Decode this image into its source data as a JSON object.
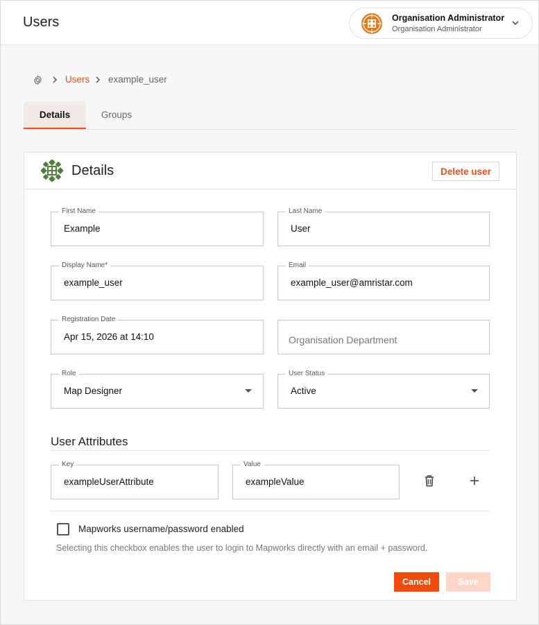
{
  "header": {
    "title": "Users",
    "org": {
      "name": "Organisation Administrator",
      "role": "Organisation Administrator",
      "logo_icon": "organisation-logo-icon",
      "logo_color": "#e07b1e"
    }
  },
  "breadcrumb": {
    "home_icon": "gear-icon",
    "users": "Users",
    "current": "example_user"
  },
  "tabs": [
    {
      "label": "Details",
      "active": true
    },
    {
      "label": "Groups",
      "active": false
    }
  ],
  "card": {
    "title": "Details",
    "icon_color": "#4f7f3a",
    "delete_label": "Delete user"
  },
  "form": {
    "first_name": {
      "label": "First Name",
      "value": "Example"
    },
    "last_name": {
      "label": "Last Name",
      "value": "User"
    },
    "display_name": {
      "label": "Display Name*",
      "value": "example_user"
    },
    "email": {
      "label": "Email",
      "value": "example_user@amristar.com"
    },
    "registration_date": {
      "label": "Registration Date",
      "value": "Apr 15, 2026 at 14:10"
    },
    "department": {
      "placeholder": "Organisation Department"
    },
    "role": {
      "label": "Role",
      "value": "Map Designer"
    },
    "user_status": {
      "label": "User Status",
      "value": "Active"
    }
  },
  "attributes": {
    "title": "User Attributes",
    "rows": [
      {
        "key_label": "Key",
        "key": "exampleUserAttribute",
        "value_label": "Value",
        "value": "exampleValue"
      }
    ]
  },
  "password_option": {
    "label": "Mapworks username/password enabled",
    "checked": false,
    "hint": "Selecting this checkbox enables the user to login to Mapworks directly with an email + password."
  },
  "actions": {
    "cancel": "Cancel",
    "save": "Save"
  },
  "colors": {
    "accent": "#e8501a",
    "save_disabled": "#fcd6c7"
  }
}
